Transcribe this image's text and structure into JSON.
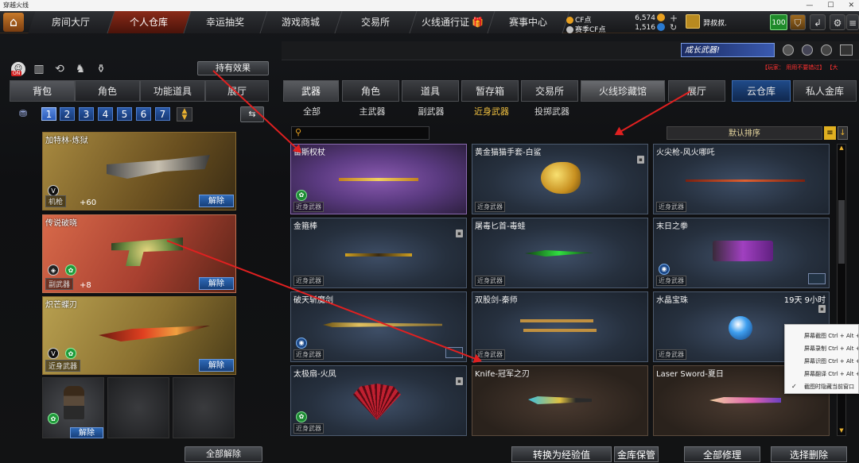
{
  "window": {
    "title": "穿越火线"
  },
  "top_nav": {
    "tabs": [
      "房间大厅",
      "个人仓库",
      "幸运抽奖",
      "游戏商城",
      "交易所",
      "火线通行证",
      "赛事中心"
    ],
    "active": "个人仓库",
    "cf_label": "CF点",
    "cf_value": "6,574",
    "season_cf_label": "赛季CF点",
    "season_cf_value": "1,516",
    "username": "羿叔叔.",
    "level": "100"
  },
  "banner": {
    "growth_weapon": "成长武器!",
    "notice_tag": "【玩家：",
    "notice_text": "用用不要错过】",
    "notice_end": "【大"
  },
  "left_panel": {
    "effects_button": "持有效果",
    "on_badge": "ON",
    "tabs": [
      "背包",
      "角色",
      "功能道具",
      "展厅"
    ],
    "active_tab": "背包",
    "pages": [
      "1",
      "2",
      "3",
      "4",
      "5",
      "6",
      "7"
    ],
    "active_page": "1",
    "items": [
      {
        "name": "加特林-炼狱",
        "type": "机枪",
        "value": "+60",
        "remove": "解除"
      },
      {
        "name": "传说破晓",
        "type": "副武器",
        "value": "+8",
        "remove": "解除"
      },
      {
        "name": "炽芒蝶刃",
        "type": "近身武器",
        "value": "",
        "remove": "解除"
      }
    ],
    "character_remove": "解除",
    "remove_all": "全部解除"
  },
  "right_panel": {
    "tabs": [
      "武器",
      "角色",
      "道具",
      "暂存箱",
      "交易所",
      "火线珍藏馆",
      "展厅"
    ],
    "active_tab": "武器",
    "cloud_tabs": [
      "云仓库",
      "私人金库"
    ],
    "subtabs": [
      "全部",
      "主武器",
      "副武器",
      "近身武器",
      "投掷武器"
    ],
    "active_subtab": "近身武器",
    "search_placeholder": "",
    "sort_label": "默认排序",
    "weapons": [
      {
        "name": "宙斯权杖",
        "tag": "近身武器"
      },
      {
        "name": "黄金猫猫手套-白鲨",
        "tag": "近身武器"
      },
      {
        "name": "火尖枪-风火哪吒",
        "tag": "近身武器"
      },
      {
        "name": "金箍棒",
        "tag": "近身武器"
      },
      {
        "name": "屠毒匕首-毒蛙",
        "tag": "近身武器"
      },
      {
        "name": "末日之拳",
        "tag": "近身武器"
      },
      {
        "name": "破天斩魔剑",
        "tag": "近身武器"
      },
      {
        "name": "双股剑-秦师",
        "tag": "近身武器"
      },
      {
        "name": "水晶宝珠",
        "tag": "近身武器",
        "timer": "19天 9小时"
      },
      {
        "name": "太极扇-火凤",
        "tag": "近身武器"
      },
      {
        "name": "Knife-冠军之刃",
        "tag": ""
      },
      {
        "name": "Laser Sword-夏日",
        "tag": ""
      }
    ],
    "bottom_buttons": [
      "转换为经验值",
      "金库保管",
      "全部修理",
      "选择删除"
    ]
  },
  "context_menu": {
    "items": [
      "屏幕截图 Ctrl + Alt + A",
      "屏幕录制 Ctrl + Alt + S",
      "屏幕识图 Ctrl + Alt + O",
      "屏幕翻译 Ctrl + Alt + F",
      "截图时隐藏当前窗口"
    ]
  },
  "colors": {
    "accent_red": "#e02020",
    "active_nav": "#8a2a18",
    "page_blue": "#2a5aa8",
    "active_subtab": "#f0c040"
  }
}
